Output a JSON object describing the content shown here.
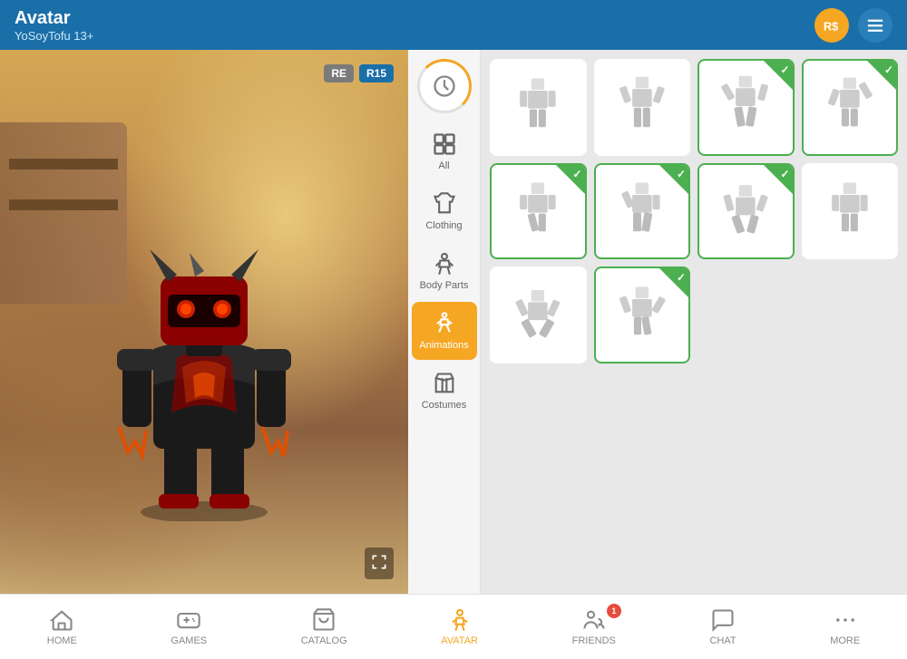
{
  "header": {
    "title": "Avatar",
    "subtitle": "YoSoyTofu 13+",
    "robux_label": "RS",
    "menu_label": "menu"
  },
  "avatar_panel": {
    "re_badge": "RE",
    "r15_badge": "R15"
  },
  "sidebar": {
    "recent_label": "",
    "items": [
      {
        "id": "all",
        "label": "All",
        "active": false
      },
      {
        "id": "clothing",
        "label": "Clothing",
        "active": false
      },
      {
        "id": "body-parts",
        "label": "Body Parts",
        "active": false
      },
      {
        "id": "animations",
        "label": "Animations",
        "active": true
      },
      {
        "id": "costumes",
        "label": "Costumes",
        "active": false
      }
    ]
  },
  "grid": {
    "items": [
      {
        "id": 1,
        "selected": false
      },
      {
        "id": 2,
        "selected": false
      },
      {
        "id": 3,
        "selected": true
      },
      {
        "id": 4,
        "selected": true
      },
      {
        "id": 5,
        "selected": true
      },
      {
        "id": 6,
        "selected": true
      },
      {
        "id": 7,
        "selected": true
      },
      {
        "id": 8,
        "selected": false
      },
      {
        "id": 9,
        "selected": false
      },
      {
        "id": 10,
        "selected": true
      }
    ]
  },
  "bottom_nav": {
    "items": [
      {
        "id": "home",
        "label": "HOME",
        "active": false
      },
      {
        "id": "games",
        "label": "GAMES",
        "active": false
      },
      {
        "id": "catalog",
        "label": "CATALOG",
        "active": false
      },
      {
        "id": "avatar",
        "label": "AVATAR",
        "active": true
      },
      {
        "id": "friends",
        "label": "FRIENDS",
        "active": false,
        "badge": "1"
      },
      {
        "id": "chat",
        "label": "CHAT",
        "active": false
      },
      {
        "id": "more",
        "label": "MORE",
        "active": false
      }
    ]
  }
}
